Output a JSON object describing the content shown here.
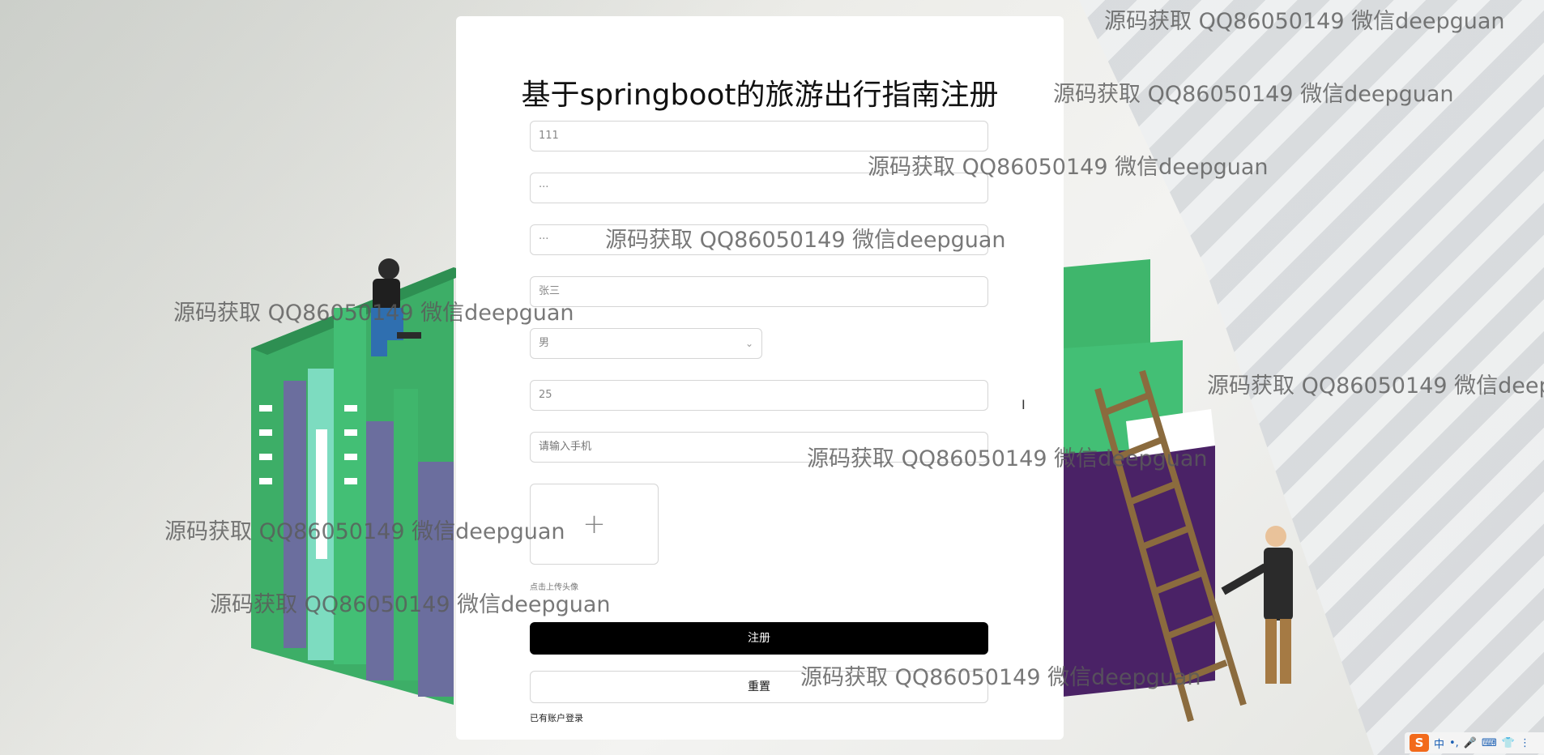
{
  "page": {
    "title": "基于springboot的旅游出行指南注册"
  },
  "form": {
    "account_value": "111",
    "password_value": "···",
    "confirm_password_value": "···",
    "name_value": "张三",
    "gender_value": "男",
    "age_value": "25",
    "phone_placeholder": "请输入手机",
    "avatar_upload_hint": "点击上传头像",
    "register_label": "注册",
    "reset_label": "重置",
    "login_link": "已有账户登录"
  },
  "watermark": {
    "text": "源码获取 QQ86050149 微信deepguan"
  },
  "tray": {
    "ime_logo": "S",
    "ime_mode": "中",
    "items": [
      "•,",
      "🎤",
      "⌨",
      "👕",
      "⋮"
    ]
  },
  "icons": {
    "select_chevron": "chevron-down-icon",
    "upload_plus": "plus-icon",
    "text_cursor": "text-cursor-icon"
  },
  "colors": {
    "card": "#ffffff",
    "primary_button": "#000000",
    "border": "#d5d5d5",
    "green_books": "#3fb66c",
    "purple_books": "#6b6e9e"
  }
}
